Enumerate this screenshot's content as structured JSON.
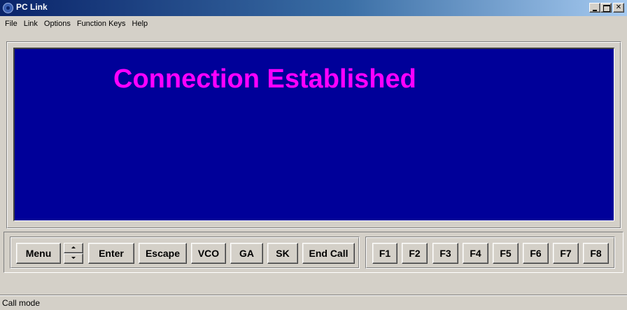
{
  "window": {
    "title": "PC Link"
  },
  "menu": {
    "items": [
      "File",
      "Link",
      "Options",
      "Function Keys",
      "Help"
    ]
  },
  "display": {
    "message": "Connection Established",
    "background_color": "#000099",
    "text_color": "#ff00ff"
  },
  "controls": {
    "menu": "Menu",
    "enter": "Enter",
    "escape": "Escape",
    "vco": "VCO",
    "ga": "GA",
    "sk": "SK",
    "end_call": "End Call"
  },
  "function_keys": [
    "F1",
    "F2",
    "F3",
    "F4",
    "F5",
    "F6",
    "F7",
    "F8"
  ],
  "status": {
    "text": "Call mode"
  },
  "icons": {
    "app": "app-icon",
    "minimize": "minimize-icon",
    "maximize": "maximize-icon",
    "close": "close-icon",
    "spin_up": "arrow-up-icon",
    "spin_down": "arrow-down-icon"
  }
}
